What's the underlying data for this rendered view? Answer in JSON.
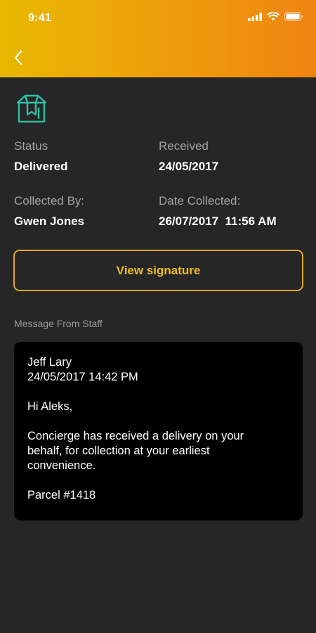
{
  "status_bar": {
    "time": "9:41",
    "icons": [
      "signal-icon",
      "wifi-icon",
      "battery-icon"
    ]
  },
  "header": {
    "gradient": [
      "#e8b800",
      "#ee8410"
    ],
    "back_icon": "chevron-left-icon"
  },
  "parcel": {
    "icon": "parcel-box-icon",
    "icon_color": "#2fbfa4",
    "status_label": "Status",
    "status_value": "Delivered",
    "received_label": "Received",
    "received_value": "24/05/2017",
    "collected_by_label": "Collected By:",
    "collected_by_value": "Gwen Jones",
    "date_collected_label": "Date Collected:",
    "date_collected_value": "26/07/2017  11:56 AM"
  },
  "signature_button": {
    "label": "View signature",
    "accent": "#f1bd1f"
  },
  "message": {
    "heading": "Message From Staff",
    "sender": "Jeff Lary",
    "timestamp": "24/05/2017 14:42 PM",
    "greeting": "Hi Aleks,",
    "body_lines": [
      "Concierge has received a delivery on your",
      "behalf, for collection at your earliest",
      "convenience."
    ],
    "parcel_ref": "Parcel #1418"
  }
}
